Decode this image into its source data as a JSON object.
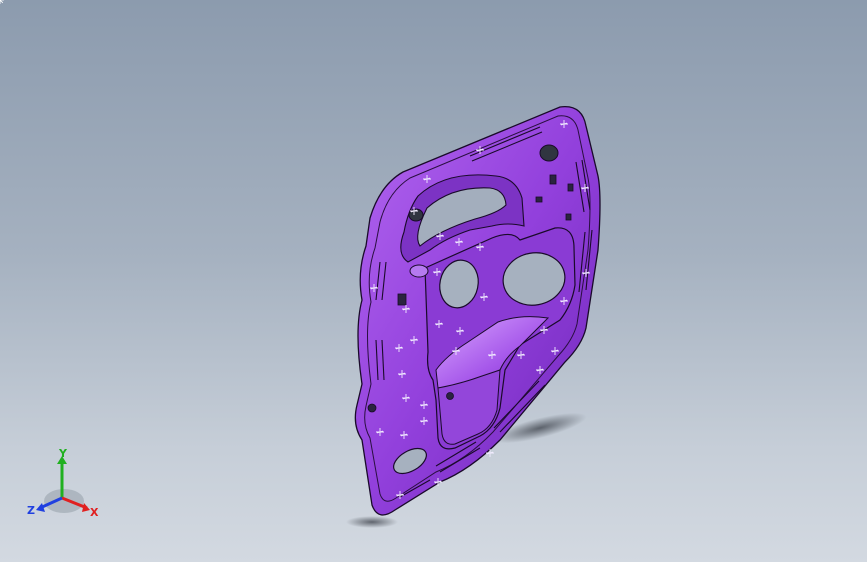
{
  "viewport": {
    "background_top": "#8c9bae",
    "background_bottom": "#d3d9e1"
  },
  "part": {
    "color": "#9b45e0",
    "color_dark": "#5a1f8c",
    "color_light": "#c98af5",
    "outline": "#1a0a2a"
  },
  "triad": {
    "x_label": "X",
    "y_label": "Y",
    "z_label": "Z",
    "x_color": "#e02020",
    "y_color": "#20b020",
    "z_color": "#2040e0"
  }
}
